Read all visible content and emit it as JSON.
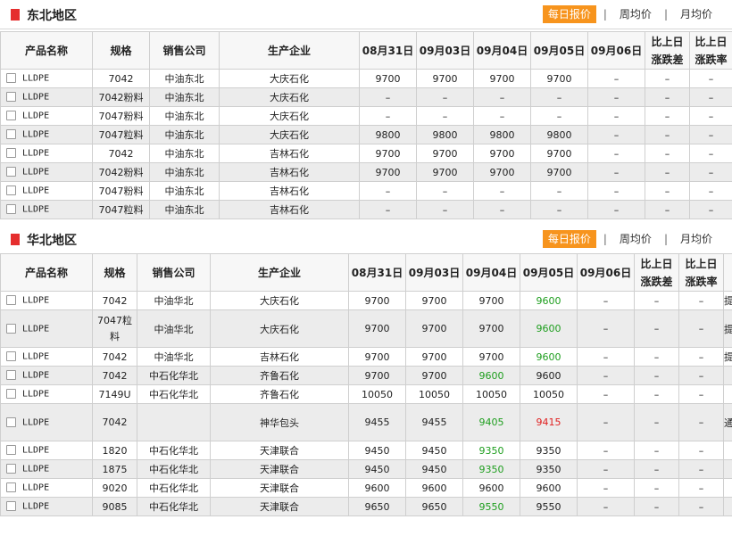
{
  "tabs": {
    "daily": "每日报价",
    "weekly": "周均价",
    "monthly": "月均价"
  },
  "northeast": {
    "title": "东北地区",
    "headers": [
      "产品名称",
      "规格",
      "销售公司",
      "生产企业",
      "08月31日",
      "09月03日",
      "09月04日",
      "09月05日",
      "09月06日",
      "比上日涨跌差",
      "比上日涨跌率"
    ],
    "rows": [
      {
        "p": "LLDPE",
        "spec": "7042",
        "sales": "中油东北",
        "prod": "大庆石化",
        "d1": "9700",
        "d2": "9700",
        "d3": "9700",
        "d4": "9700",
        "d5": "–",
        "diff": "–",
        "rate": "–"
      },
      {
        "p": "LLDPE",
        "spec": "7042粉料",
        "sales": "中油东北",
        "prod": "大庆石化",
        "d1": "–",
        "d2": "–",
        "d3": "–",
        "d4": "–",
        "d5": "–",
        "diff": "–",
        "rate": "–"
      },
      {
        "p": "LLDPE",
        "spec": "7047粉料",
        "sales": "中油东北",
        "prod": "大庆石化",
        "d1": "–",
        "d2": "–",
        "d3": "–",
        "d4": "–",
        "d5": "–",
        "diff": "–",
        "rate": "–"
      },
      {
        "p": "LLDPE",
        "spec": "7047粒料",
        "sales": "中油东北",
        "prod": "大庆石化",
        "d1": "9800",
        "d2": "9800",
        "d3": "9800",
        "d4": "9800",
        "d5": "–",
        "diff": "–",
        "rate": "–"
      },
      {
        "p": "LLDPE",
        "spec": "7042",
        "sales": "中油东北",
        "prod": "吉林石化",
        "d1": "9700",
        "d2": "9700",
        "d3": "9700",
        "d4": "9700",
        "d5": "–",
        "diff": "–",
        "rate": "–"
      },
      {
        "p": "LLDPE",
        "spec": "7042粉料",
        "sales": "中油东北",
        "prod": "吉林石化",
        "d1": "9700",
        "d2": "9700",
        "d3": "9700",
        "d4": "9700",
        "d5": "–",
        "diff": "–",
        "rate": "–"
      },
      {
        "p": "LLDPE",
        "spec": "7047粉料",
        "sales": "中油东北",
        "prod": "吉林石化",
        "d1": "–",
        "d2": "–",
        "d3": "–",
        "d4": "–",
        "d5": "–",
        "diff": "–",
        "rate": "–"
      },
      {
        "p": "LLDPE",
        "spec": "7047粒料",
        "sales": "中油东北",
        "prod": "吉林石化",
        "d1": "–",
        "d2": "–",
        "d3": "–",
        "d4": "–",
        "d5": "–",
        "diff": "–",
        "rate": "–"
      }
    ]
  },
  "north": {
    "title": "华北地区",
    "headers": [
      "产品名称",
      "规格",
      "销售公司",
      "生产企业",
      "08月31日",
      "09月03日",
      "09月04日",
      "09月05日",
      "09月06日",
      "比上日涨跌差",
      "比上日涨跌率"
    ],
    "rows": [
      {
        "p": "LLDPE",
        "spec": "7042",
        "sales": "中油华北",
        "prod": "大庆石化",
        "d1": "9700",
        "d2": "9700",
        "d3": "9700",
        "d4": "9600",
        "d4c": "green",
        "d5": "–",
        "diff": "–",
        "rate": "–",
        "extra": "提"
      },
      {
        "p": "LLDPE",
        "spec": "7047粒料",
        "sales": "中油华北",
        "prod": "大庆石化",
        "d1": "9700",
        "d2": "9700",
        "d3": "9700",
        "d4": "9600",
        "d4c": "green",
        "d5": "–",
        "diff": "–",
        "rate": "–",
        "extra": "提",
        "tall": true
      },
      {
        "p": "LLDPE",
        "spec": "7042",
        "sales": "中油华北",
        "prod": "吉林石化",
        "d1": "9700",
        "d2": "9700",
        "d3": "9700",
        "d4": "9600",
        "d4c": "green",
        "d5": "–",
        "diff": "–",
        "rate": "–",
        "extra": "提"
      },
      {
        "p": "LLDPE",
        "spec": "7042",
        "sales": "中石化华北",
        "prod": "齐鲁石化",
        "d1": "9700",
        "d2": "9700",
        "d3": "9600",
        "d3c": "green",
        "d4": "9600",
        "d5": "–",
        "diff": "–",
        "rate": "–",
        "extra": ""
      },
      {
        "p": "LLDPE",
        "spec": "7149U",
        "sales": "中石化华北",
        "prod": "齐鲁石化",
        "d1": "10050",
        "d2": "10050",
        "d3": "10050",
        "d4": "10050",
        "d5": "–",
        "diff": "–",
        "rate": "–",
        "extra": ""
      },
      {
        "p": "LLDPE",
        "spec": "7042",
        "sales": "",
        "prod": "神华包头",
        "d1": "9455",
        "d2": "9455",
        "d3": "9405",
        "d3c": "green",
        "d4": "9415",
        "d4c": "red",
        "d5": "–",
        "diff": "–",
        "rate": "–",
        "extra": "通",
        "tall": true
      },
      {
        "p": "LLDPE",
        "spec": "1820",
        "sales": "中石化华北",
        "prod": "天津联合",
        "d1": "9450",
        "d2": "9450",
        "d3": "9350",
        "d3c": "green",
        "d4": "9350",
        "d5": "–",
        "diff": "–",
        "rate": "–",
        "extra": ""
      },
      {
        "p": "LLDPE",
        "spec": "1875",
        "sales": "中石化华北",
        "prod": "天津联合",
        "d1": "9450",
        "d2": "9450",
        "d3": "9350",
        "d3c": "green",
        "d4": "9350",
        "d5": "–",
        "diff": "–",
        "rate": "–",
        "extra": ""
      },
      {
        "p": "LLDPE",
        "spec": "9020",
        "sales": "中石化华北",
        "prod": "天津联合",
        "d1": "9600",
        "d2": "9600",
        "d3": "9600",
        "d4": "9600",
        "d5": "–",
        "diff": "–",
        "rate": "–",
        "extra": ""
      },
      {
        "p": "LLDPE",
        "spec": "9085",
        "sales": "中石化华北",
        "prod": "天津联合",
        "d1": "9650",
        "d2": "9650",
        "d3": "9550",
        "d3c": "green",
        "d4": "9550",
        "d5": "–",
        "diff": "–",
        "rate": "–",
        "extra": ""
      }
    ]
  },
  "colors": {
    "accent": "#f7941d",
    "marker": "#e52e2e",
    "down": "#1e9e1e",
    "up": "#e02020"
  }
}
